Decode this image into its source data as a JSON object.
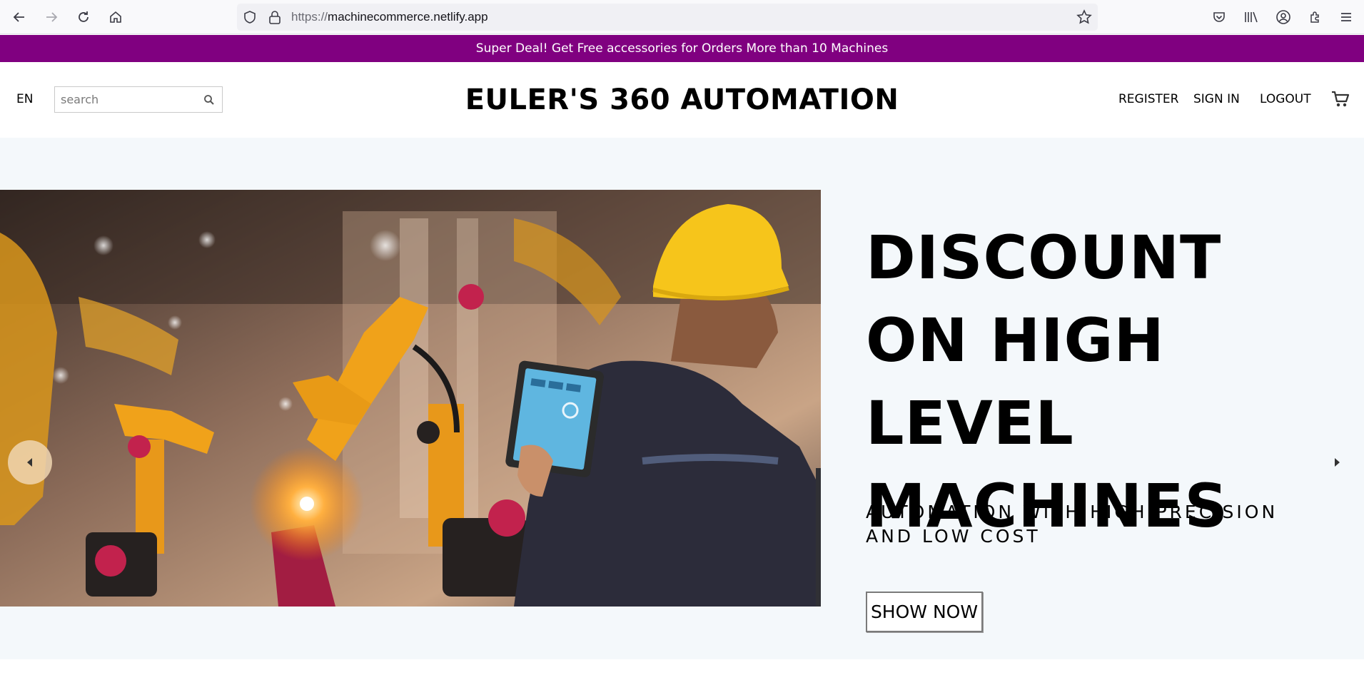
{
  "browser": {
    "url_scheme": "https://",
    "url_host": "machinecommerce.netlify.app"
  },
  "promo": {
    "text": "Super Deal! Get Free accessories for Orders More than 10 Machines"
  },
  "header": {
    "language": "EN",
    "search_placeholder": "search",
    "logo": "EULER'S 360 AUTOMATION",
    "register": "REGISTER",
    "sign_in": "SIGN IN",
    "logout": "LOGOUT"
  },
  "hero": {
    "title": "DISCOUNT ON HIGH LEVEL MACHINES",
    "subtitle": "AUTOMATION WITH HIGH PRECISION AND LOW COST",
    "button": "SHOW NOW"
  },
  "colors": {
    "promo_bg": "#800080",
    "hero_bg": "#f4f8fb",
    "robot_orange": "#f0a21a",
    "helmet_yellow": "#f6c51b"
  }
}
